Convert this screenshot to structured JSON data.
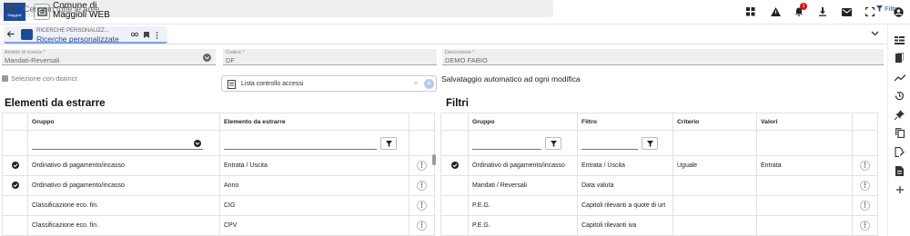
{
  "app": {
    "logo_text": "Maggioli",
    "title": "Comune di Maggioli WEB"
  },
  "search": {
    "placeholder": "Cerca in tutte le aree...",
    "filter_label": "Filtra"
  },
  "topbar_icons": [
    "grid-icon",
    "warning-icon",
    "bell-icon",
    "download-icon",
    "mail-icon",
    "fullscreen-icon",
    "account-icon"
  ],
  "notifications_count": "1",
  "tab": {
    "breadcrumb": "RICERCHE PERSONALIZZ...",
    "title": "Ricerche personalizzate"
  },
  "form": {
    "ambito": {
      "label": "Ambito di ricerca *",
      "value": "Mandati-Reversali"
    },
    "codice": {
      "label": "Codice *",
      "value": "DF"
    },
    "descrizione": {
      "label": "Descrizione *",
      "value": "DEMO FABIO"
    },
    "selezione_distinct": "Selezione con distinct",
    "lista_controllo": "Lista controllo accessi",
    "salvataggio": "Salvataggio automatico ad ogni modifica"
  },
  "elementi": {
    "title": "Elementi da estrarre",
    "headers": [
      "Gruppo",
      "Elemento da estrarre"
    ],
    "rows": [
      {
        "checked": true,
        "gruppo": "Ordinativo di pagamento/incasso",
        "elemento": "Entrata / Uscita"
      },
      {
        "checked": true,
        "gruppo": "Ordinativo di pagamento/incasso",
        "elemento": "Anno"
      },
      {
        "checked": false,
        "gruppo": "Classificazione eco. fin.",
        "elemento": "CIG"
      },
      {
        "checked": false,
        "gruppo": "Classificazione eco. fin.",
        "elemento": "CPV"
      }
    ]
  },
  "filtri": {
    "title": "Filtri",
    "headers": [
      "Gruppo",
      "Filtro",
      "Criterio",
      "Valori"
    ],
    "rows": [
      {
        "checked": true,
        "gruppo": "Ordinativo di pagamento/incasso",
        "filtro": "Entrata / Uscita",
        "criterio": "Uguale",
        "valori": "Entrata"
      },
      {
        "checked": false,
        "gruppo": "Mandati / Reversali",
        "filtro": "Data valuta",
        "criterio": "",
        "valori": ""
      },
      {
        "checked": false,
        "gruppo": "P.E.G.",
        "filtro": "Capitoli rilevanti a quote di urt",
        "criterio": "",
        "valori": ""
      },
      {
        "checked": false,
        "gruppo": "P.E.G.",
        "filtro": "Capitoli rilevanti iva",
        "criterio": "",
        "valori": ""
      }
    ]
  },
  "sidebar_icons": [
    "fields-icon",
    "book-icon",
    "trend-icon",
    "history-icon",
    "pin-icon",
    "copy-icon",
    "edit-doc-icon",
    "document-icon",
    "add-icon"
  ],
  "colors": {
    "brand": "#1d4b9b",
    "accent_light": "#b7c9ea"
  }
}
